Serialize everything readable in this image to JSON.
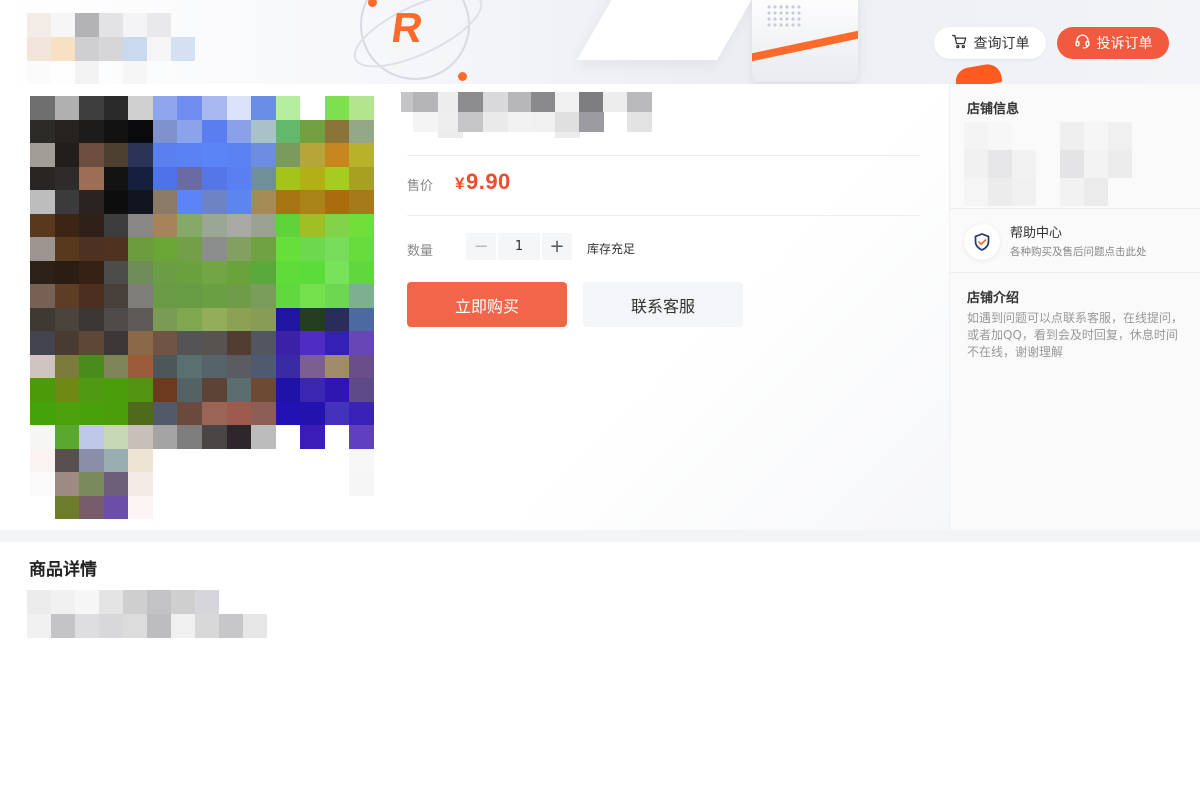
{
  "header": {
    "query_order_label": "查询订单",
    "complain_order_label": "投诉订单",
    "deco_letter": "R"
  },
  "product": {
    "price_label": "售价",
    "currency": "¥",
    "price": "9.90",
    "quantity_label": "数量",
    "quantity": "1",
    "minus": "−",
    "plus": "+",
    "stock_text": "库存充足",
    "buy_label": "立即购买",
    "service_label": "联系客服"
  },
  "sidebar": {
    "shop_info_title": "店铺信息",
    "help_title": "帮助中心",
    "help_desc": "各种购买及售后问题点击此处",
    "intro_title": "店铺介绍",
    "intro_text": "如遇到问题可以点联系客服，在线提问，或者加QQ，看到会及时回复，休息时间不在线，谢谢理解"
  },
  "details": {
    "title": "商品详情"
  },
  "colors": {
    "accent": "#f36548",
    "price": "#f04b2b",
    "complain_button": "#f25a40"
  },
  "icons": [
    "cart-icon",
    "headset-icon",
    "shield-check-icon"
  ]
}
